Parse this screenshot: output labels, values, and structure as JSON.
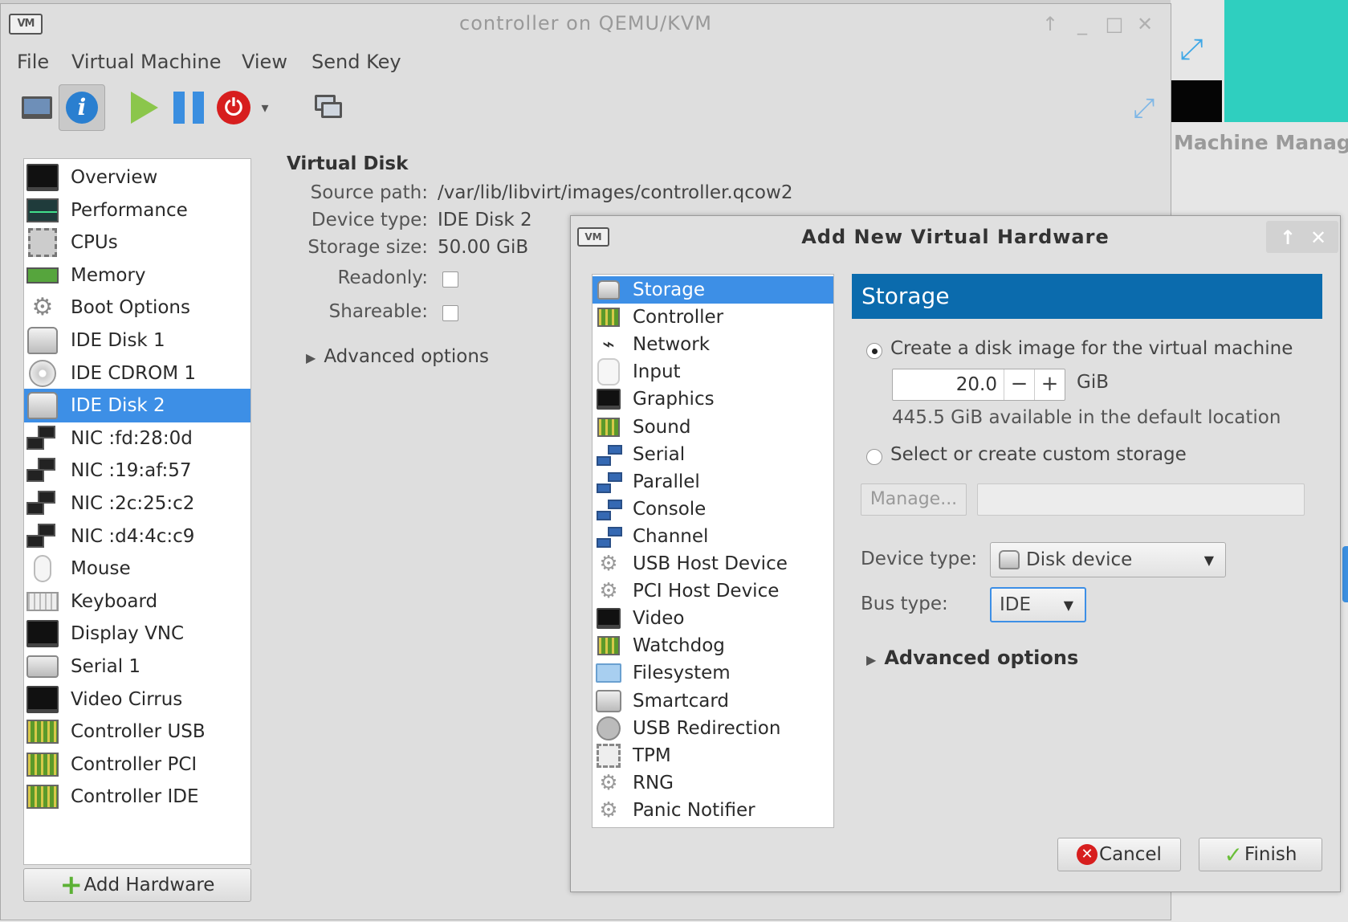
{
  "main_window": {
    "title": "controller on QEMU/KVM",
    "controls": [
      "↑",
      "_",
      "□",
      "✕"
    ],
    "menu": [
      "File",
      "Virtual Machine",
      "View",
      "Send Key"
    ],
    "toolbar": {
      "buttons": [
        "monitor-icon",
        "info-icon",
        "play-icon",
        "pause-icon",
        "power-icon",
        "dropdown-arrow-icon",
        "screens-icon",
        "resize-icon"
      ],
      "info_glyph": "i",
      "power_glyph": "⏻",
      "dropdown_glyph": "▾"
    }
  },
  "background": {
    "partial_title": "Machine Manage"
  },
  "devices": [
    {
      "label": "Overview",
      "icon": "monitor"
    },
    {
      "label": "Performance",
      "icon": "perf"
    },
    {
      "label": "CPUs",
      "icon": "chip"
    },
    {
      "label": "Memory",
      "icon": "memory"
    },
    {
      "label": "Boot Options",
      "icon": "gears"
    },
    {
      "label": "IDE Disk 1",
      "icon": "disk"
    },
    {
      "label": "IDE CDROM 1",
      "icon": "cd"
    },
    {
      "label": "IDE Disk 2",
      "icon": "disk",
      "selected": true
    },
    {
      "label": "NIC :fd:28:0d",
      "icon": "nic"
    },
    {
      "label": "NIC :19:af:57",
      "icon": "nic"
    },
    {
      "label": "NIC :2c:25:c2",
      "icon": "nic"
    },
    {
      "label": "NIC :d4:4c:c9",
      "icon": "nic"
    },
    {
      "label": "Mouse",
      "icon": "mouse"
    },
    {
      "label": "Keyboard",
      "icon": "keyboard"
    },
    {
      "label": "Display VNC",
      "icon": "monitor"
    },
    {
      "label": "Serial 1",
      "icon": "printer"
    },
    {
      "label": "Video Cirrus",
      "icon": "monitor"
    },
    {
      "label": "Controller USB",
      "icon": "card"
    },
    {
      "label": "Controller PCI",
      "icon": "card"
    },
    {
      "label": "Controller IDE",
      "icon": "card"
    }
  ],
  "add_hardware_label": "Add Hardware",
  "details": {
    "title": "Virtual Disk",
    "source_path_label": "Source path:",
    "source_path": "/var/lib/libvirt/images/controller.qcow2",
    "device_type_label": "Device type:",
    "device_type": "IDE Disk 2",
    "storage_size_label": "Storage size:",
    "storage_size": "50.00 GiB",
    "readonly_label": "Readonly:",
    "shareable_label": "Shareable:",
    "advanced_label": "Advanced options"
  },
  "dialog": {
    "title": "Add New Virtual Hardware",
    "controls": [
      "↑",
      "✕"
    ],
    "hardware_types": [
      {
        "label": "Storage",
        "icon": "disk",
        "selected": true
      },
      {
        "label": "Controller",
        "icon": "card"
      },
      {
        "label": "Network",
        "icon": "network"
      },
      {
        "label": "Input",
        "icon": "plain"
      },
      {
        "label": "Graphics",
        "icon": "monitor"
      },
      {
        "label": "Sound",
        "icon": "card"
      },
      {
        "label": "Serial",
        "icon": "nic"
      },
      {
        "label": "Parallel",
        "icon": "nic"
      },
      {
        "label": "Console",
        "icon": "nic"
      },
      {
        "label": "Channel",
        "icon": "nic"
      },
      {
        "label": "USB Host Device",
        "icon": "gearsmall"
      },
      {
        "label": "PCI Host Device",
        "icon": "gearsmall"
      },
      {
        "label": "Video",
        "icon": "monitor"
      },
      {
        "label": "Watchdog",
        "icon": "card"
      },
      {
        "label": "Filesystem",
        "icon": "folder"
      },
      {
        "label": "Smartcard",
        "icon": "printer"
      },
      {
        "label": "USB Redirection",
        "icon": "usbredir"
      },
      {
        "label": "TPM",
        "icon": "tpm"
      },
      {
        "label": "RNG",
        "icon": "gearsmall"
      },
      {
        "label": "Panic Notifier",
        "icon": "gearsmall"
      }
    ],
    "header": "Storage",
    "option_create_label": "Create a disk image for the virtual machine",
    "size_value": "20.0",
    "minus": "−",
    "plus": "+",
    "size_unit": "GiB",
    "available_text": "445.5 GiB available in the default location",
    "option_custom_label": "Select or create custom storage",
    "manage_label": "Manage...",
    "custom_path_value": "",
    "device_type_label": "Device type:",
    "device_type_value": "Disk device",
    "bus_type_label": "Bus type:",
    "bus_type_value": "IDE",
    "advanced_label": "Advanced options",
    "cancel_label": "Cancel",
    "finish_label": "Finish"
  },
  "colors": {
    "selection": "#3d8fe6",
    "header": "#0b6bad",
    "power": "#d71e1e",
    "play": "#8bc64b",
    "teal": "#2fcfbf"
  }
}
